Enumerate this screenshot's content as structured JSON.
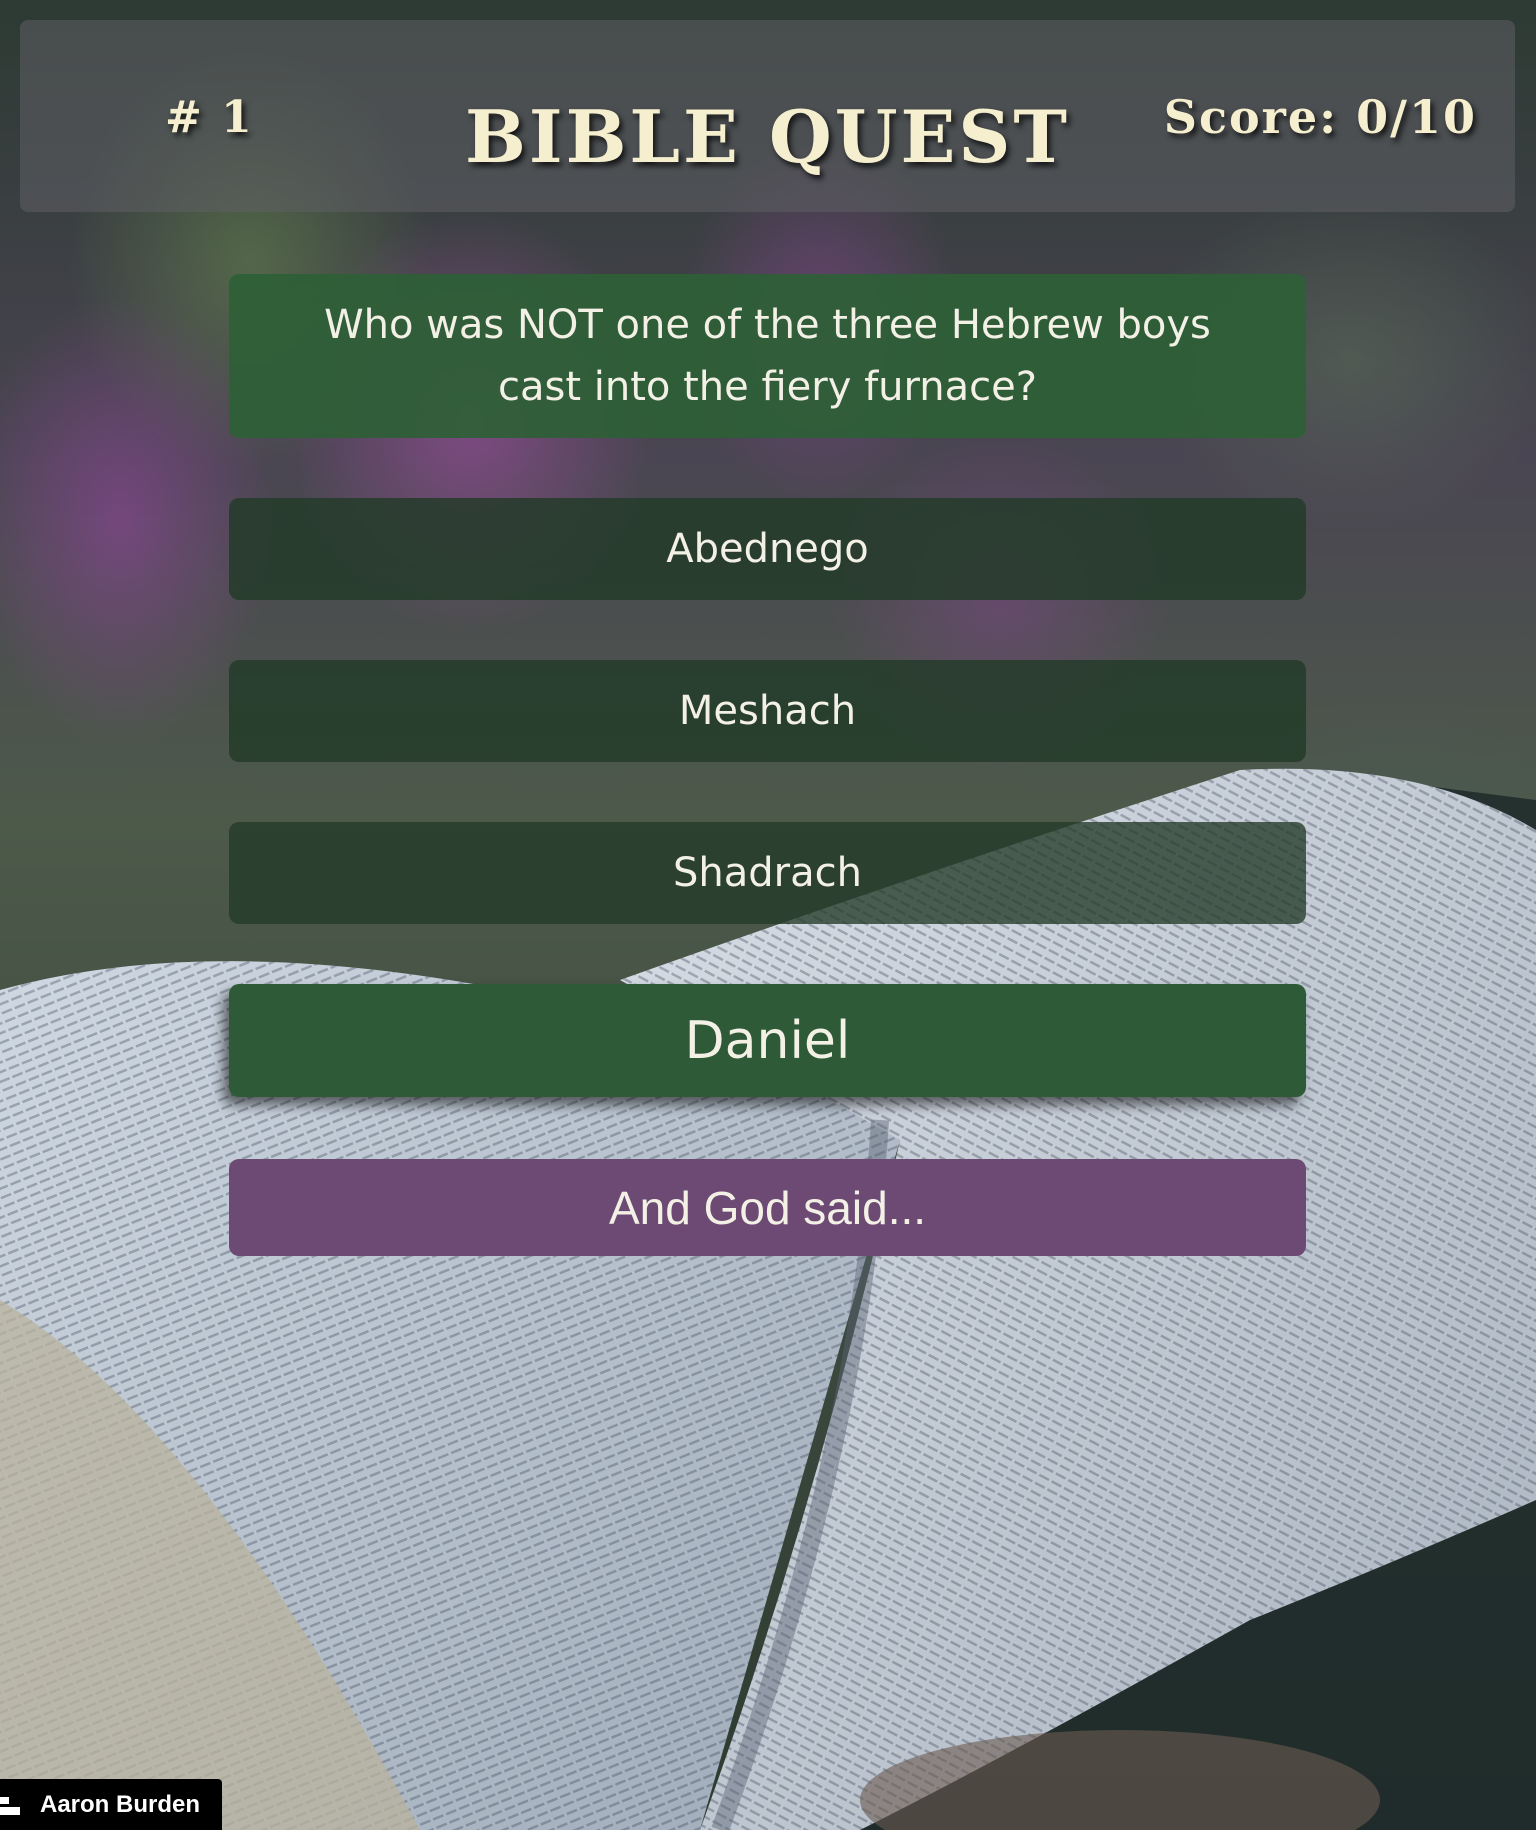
{
  "header": {
    "question_number": "# 1",
    "title": "BIBLE QUEST",
    "score": "Score: 0/10"
  },
  "question": {
    "text": "Who was NOT one of the three Hebrew boys cast into the fiery furnace?"
  },
  "options": [
    {
      "label": "Abednego"
    },
    {
      "label": "Meshach"
    },
    {
      "label": "Shadrach"
    },
    {
      "label": "Daniel",
      "selected": true
    }
  ],
  "hint_button": {
    "label": "And God said..."
  },
  "photo_credit": {
    "name": "Aaron Burden",
    "icon": "camera-icon"
  },
  "colors": {
    "title_text": "#f6efcf",
    "question_bg": "#2e5f36",
    "option_bg": "#223a28",
    "selected_bg": "#2e5a38",
    "hint_bg": "#6c4a74"
  }
}
